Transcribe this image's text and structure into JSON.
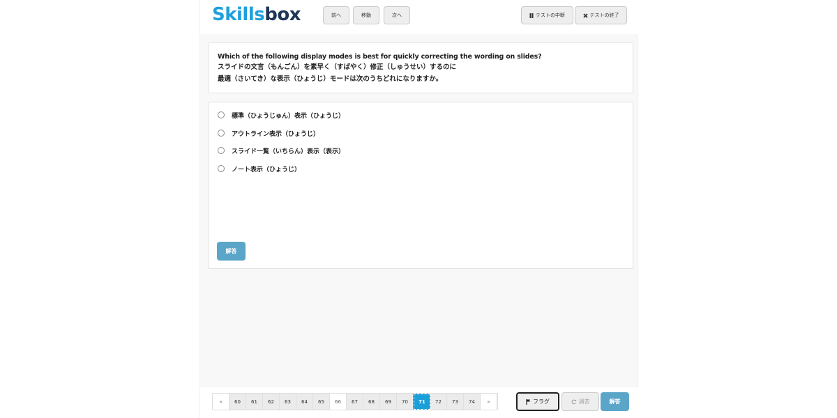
{
  "header": {
    "logo_part1": "Skills",
    "logo_part2": "box",
    "nav": {
      "prev": "前へ",
      "move": "移動",
      "next": "次へ"
    },
    "pause_label": "テストの中断",
    "end_label": "テストの終了"
  },
  "question": {
    "english": "Which of the following display modes is best for quickly correcting the wording on slides?",
    "japanese_line1": "スライドの文言（もんごん）を素早く（すばやく）修正（しゅうせい）するのに",
    "japanese_line2": "最適（さいてき）な表示（ひょうじ）モードは次のうちどれになりますか。"
  },
  "options": [
    "標準（ひょうじゅん）表示（ひょうじ）",
    "アウトライン表示（ひょうじ）",
    "スライド一覧（いちらん）表示（表示）",
    "ノート表示（ひょうじ）"
  ],
  "answer_button": "解答",
  "pagination": {
    "prev": "«",
    "next": "»",
    "pages": [
      "60",
      "61",
      "62",
      "63",
      "64",
      "65",
      "66",
      "67",
      "68",
      "69",
      "70",
      "71",
      "72",
      "73",
      "74"
    ],
    "current": "71",
    "unvisited": "66"
  },
  "footer": {
    "flag_label": "フラグ",
    "erase_label": "消去",
    "submit_label": "解答"
  },
  "colors": {
    "accent": "#1a9fd9",
    "answer_button": "#5ba6c8",
    "logo_blue": "#1ea0dc",
    "logo_navy": "#1d3557"
  },
  "icons": {
    "pause": "pause-icon",
    "close": "close-icon",
    "flag": "flag-icon",
    "refresh": "refresh-icon"
  }
}
